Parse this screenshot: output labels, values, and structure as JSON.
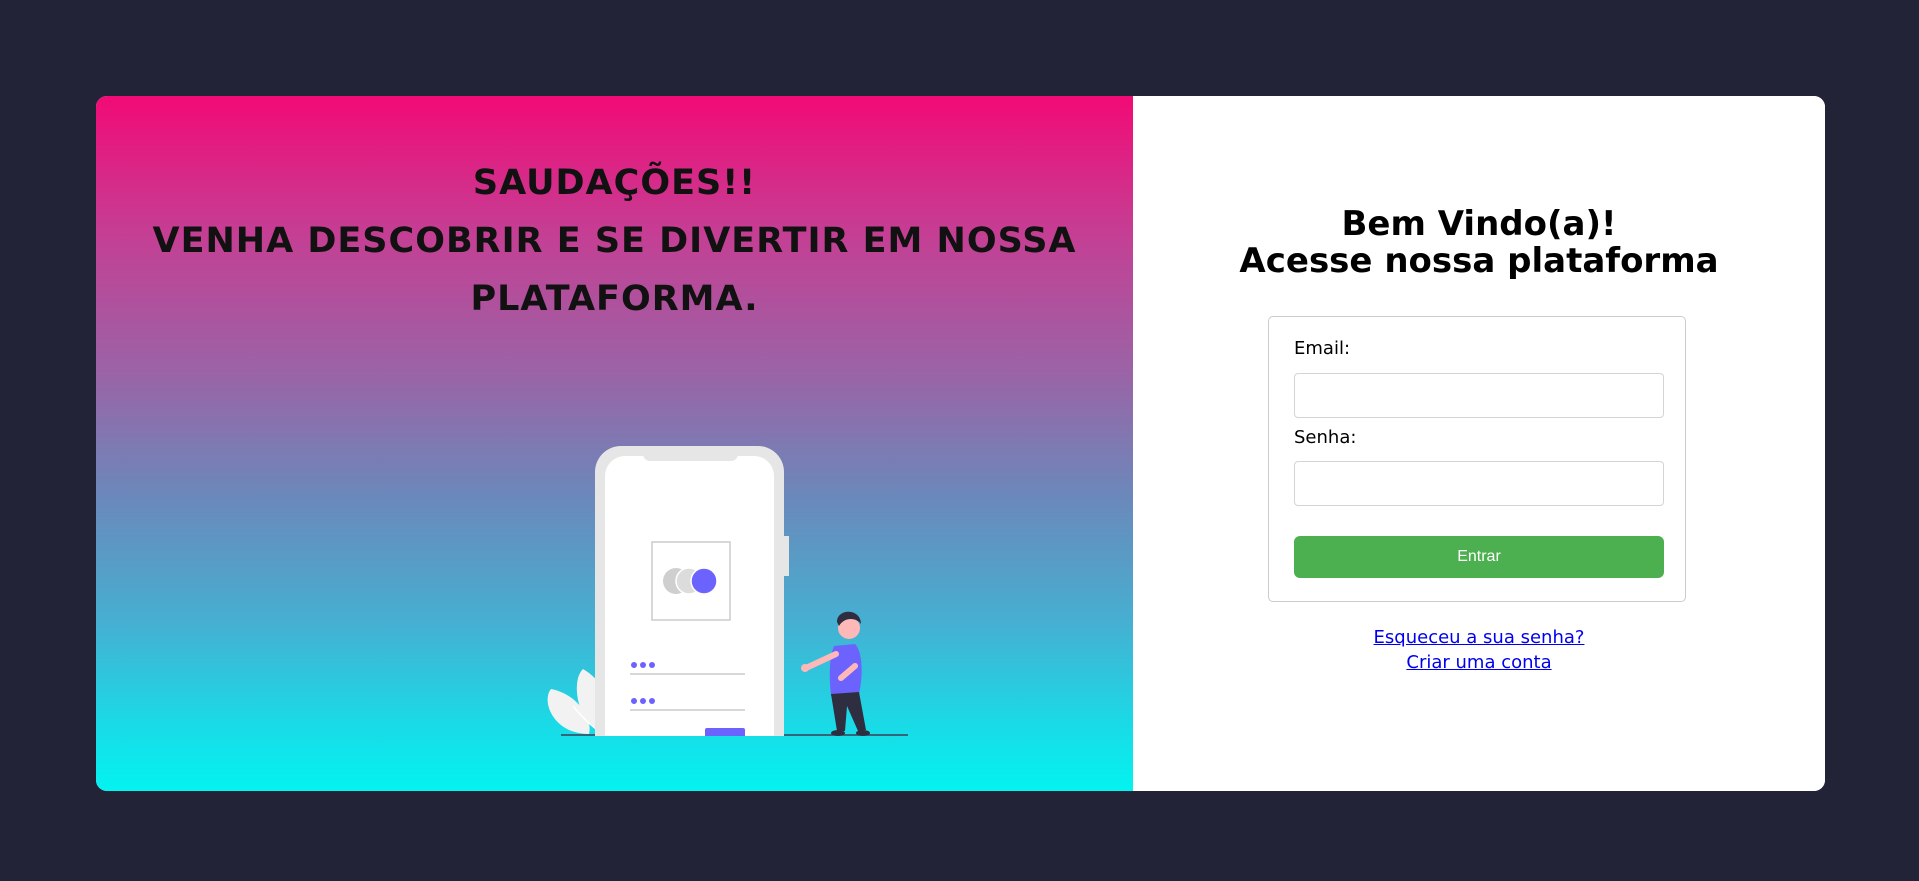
{
  "left": {
    "greeting_line1": "SAUDAÇÕES!!",
    "greeting_line2": "VENHA DESCOBRIR E SE DIVERTIR EM NOSSA",
    "greeting_line3": "PLATAFORMA.",
    "gradient_top": "#f20a76",
    "gradient_bottom": "#03f3f0",
    "illustration_accent": "#6c63ff"
  },
  "right": {
    "title_line1": "Bem Vindo(a)!",
    "title_line2": "Acesse nossa plataforma",
    "email_label": "Email:",
    "email_value": "",
    "password_label": "Senha:",
    "password_value": "",
    "submit_label": "Entrar",
    "submit_color": "#4caf50",
    "forgot_link": "Esqueceu a sua senha?",
    "create_link": "Criar uma conta"
  },
  "colors": {
    "page_background": "#222336",
    "card_background": "#ffffff",
    "link_color": "#0000ee"
  }
}
